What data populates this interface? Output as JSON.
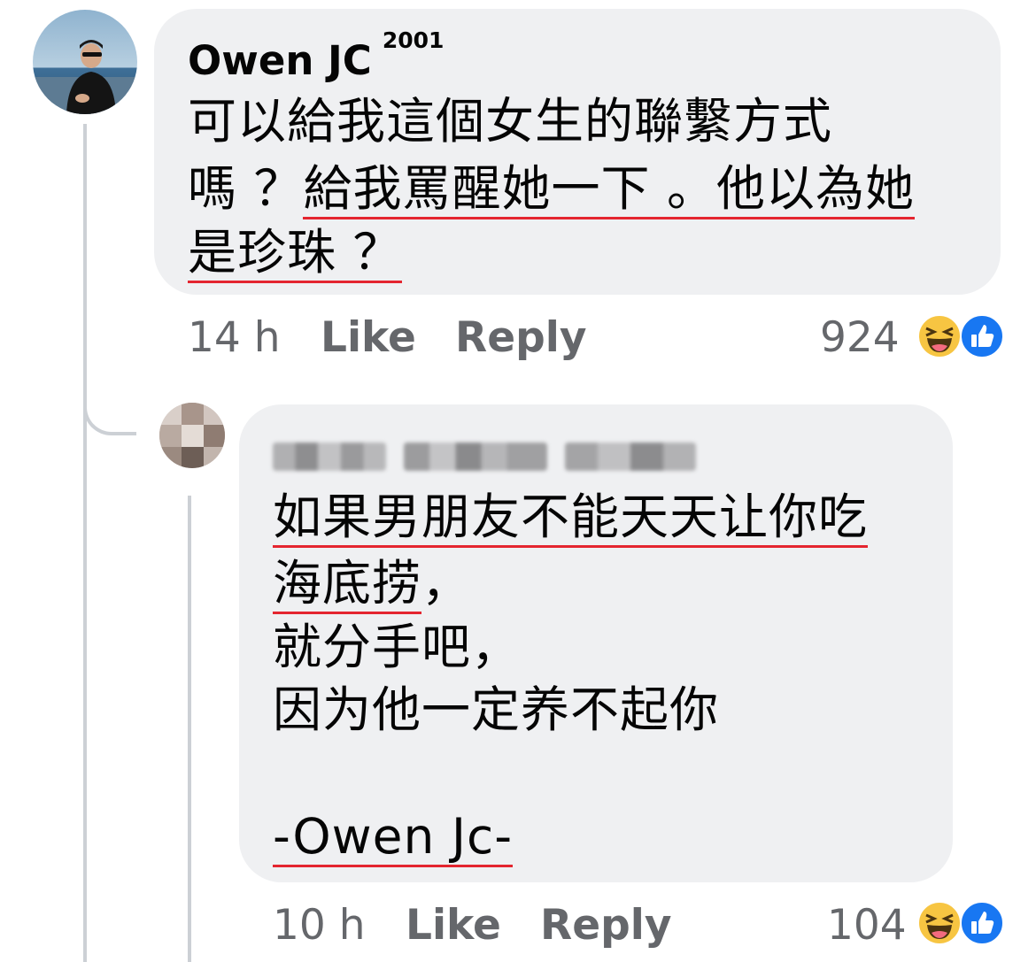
{
  "comment": {
    "author": "Owen JC",
    "badge": "2001",
    "text_lines": [
      "可以給我這個女生的聯繫方式",
      "嗎 ？",
      "給我罵醒她一下 。他以為她",
      "是珍珠 ？"
    ],
    "time": "14 h",
    "like_label": "Like",
    "reply_label": "Reply",
    "reaction_count": "924",
    "reactions": [
      "haha-icon",
      "like-icon"
    ]
  },
  "reply": {
    "text_lines": [
      "如果男朋友不能天天让你吃",
      "海底捞",
      "，",
      "就分手吧，",
      "因为他一定养不起你",
      "-Owen Jc-"
    ],
    "time": "10 h",
    "like_label": "Like",
    "reply_label": "Reply",
    "reaction_count": "104",
    "reactions": [
      "haha-icon",
      "like-icon"
    ]
  },
  "colors": {
    "bubble": "#eff0f2",
    "underline": "#e4252f",
    "meta": "#65676b",
    "like_blue": "#1877f2",
    "haha_yellow": "#f7c542"
  }
}
